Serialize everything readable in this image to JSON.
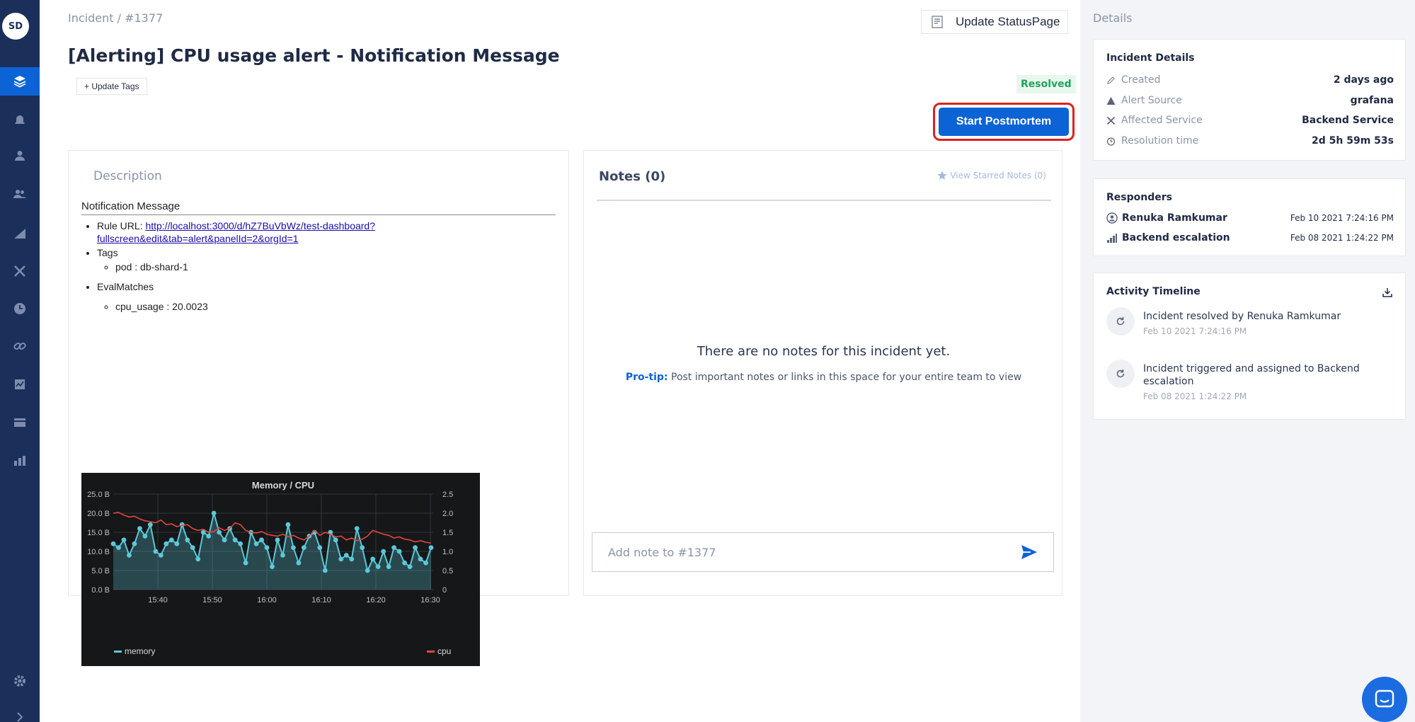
{
  "nav": {
    "avatar": "SD",
    "items": [
      "layers-icon",
      "alarm-icon",
      "user-icon",
      "team-icon",
      "signal-icon",
      "tools-icon",
      "clock-icon",
      "link-icon",
      "report-icon",
      "card-icon",
      "chart-icon"
    ],
    "bottom": [
      "settings-icon",
      "expand-icon"
    ]
  },
  "header": {
    "breadcrumb": "Incident / #1377",
    "title": "[Alerting] CPU usage alert - Notification Message",
    "tags_button": "+ Update Tags",
    "status_page_button": "Update StatusPage",
    "status_badge": "Resolved",
    "postmortem_button": "Start Postmortem"
  },
  "description": {
    "label": "Description",
    "heading": "Notification Message",
    "rule_url_label": "Rule URL: ",
    "rule_url_line1": "http://localhost:3000/d/hZ7BuVbWz/test-dashboard?",
    "rule_url_line2": "fullscreen&edit&tab=alert&panelId=2&orgId=1",
    "tags_label": "Tags",
    "tag_item": "pod : db-shard-1",
    "evalmatches_label": "EvalMatches",
    "eval_item": "cpu_usage : 20.0023"
  },
  "chart_data": {
    "type": "line",
    "title": "Memory / CPU",
    "x": [
      "15:40",
      "15:50",
      "16:00",
      "16:10",
      "16:20",
      "16:30"
    ],
    "left_ticks": [
      "25.0 B",
      "20.0 B",
      "15.0 B",
      "10.0 B",
      "5.0 B",
      "0.0 B"
    ],
    "right_ticks": [
      "2.5",
      "2.0",
      "1.5",
      "1.0",
      "0.5",
      "0"
    ],
    "ylim_left": [
      0,
      25
    ],
    "ylim_right": [
      0,
      2.5
    ],
    "series": [
      {
        "name": "memory",
        "color": "#5bc8d8",
        "values": [
          12,
          11,
          13,
          9,
          12,
          16,
          14,
          17,
          10,
          9,
          12,
          13,
          12,
          17,
          13,
          11,
          8,
          15,
          14,
          20,
          15,
          13,
          16,
          13,
          12,
          7,
          15,
          12,
          13,
          11,
          6,
          13,
          9,
          17,
          11,
          7,
          11,
          14,
          15,
          11,
          5,
          15,
          13,
          8,
          9,
          8,
          16,
          11,
          5,
          8,
          6,
          10,
          6,
          11,
          10,
          7,
          6,
          11,
          8,
          7,
          11
        ]
      },
      {
        "name": "cpu",
        "color": "#e0473e",
        "values": [
          2.0,
          2.02,
          1.95,
          1.9,
          1.92,
          1.85,
          1.8,
          1.78,
          1.75,
          1.82,
          1.7,
          1.72,
          1.65,
          1.68,
          1.7,
          1.6,
          1.55,
          1.58,
          1.5,
          1.52,
          1.62,
          1.55,
          1.6,
          1.75,
          1.7,
          1.55,
          1.5,
          1.48,
          1.52,
          1.45,
          1.42,
          1.4,
          1.45,
          1.38,
          1.42,
          1.35,
          1.3,
          1.4,
          1.55,
          1.42,
          1.5,
          1.45,
          1.38,
          1.4,
          1.3,
          1.35,
          1.28,
          1.32,
          1.4,
          1.55,
          1.5,
          1.45,
          1.42,
          1.35,
          1.38,
          1.32,
          1.3,
          1.25,
          1.28,
          1.24,
          1.22
        ]
      }
    ]
  },
  "notes": {
    "title": "Notes (0)",
    "starred": "View Starred Notes (0)",
    "empty": "There are no notes for this incident yet.",
    "protip_label": "Pro-tip:",
    "protip_text": " Post important notes or links in this space for your entire team to view",
    "input_placeholder": "Add note to #1377"
  },
  "details": {
    "header": "Details",
    "card_title": "Incident Details",
    "rows": [
      {
        "key": "Created",
        "value": "2 days ago"
      },
      {
        "key": "Alert Source",
        "value": "grafana"
      },
      {
        "key": "Affected Service",
        "value": "Backend Service"
      },
      {
        "key": "Resolution time",
        "value": "2d 5h 59m 53s"
      }
    ]
  },
  "responders": {
    "title": "Responders",
    "items": [
      {
        "name": "Renuka Ramkumar",
        "date": "Feb 10 2021 7:24:16 PM"
      },
      {
        "name": "Backend escalation",
        "date": "Feb 08 2021 1:24:22 PM"
      }
    ]
  },
  "timeline": {
    "title": "Activity Timeline",
    "items": [
      {
        "text": "Incident resolved by Renuka Ramkumar",
        "date": "Feb 10 2021 7:24:16 PM"
      },
      {
        "text": "Incident triggered and assigned to Backend escalation",
        "date": "Feb 08 2021 1:24:22 PM"
      }
    ]
  },
  "colors": {
    "nav_bg": "#1b2f5b",
    "primary": "#0c63d6",
    "resolved": "#22a35b",
    "highlight": "#e0201f"
  }
}
